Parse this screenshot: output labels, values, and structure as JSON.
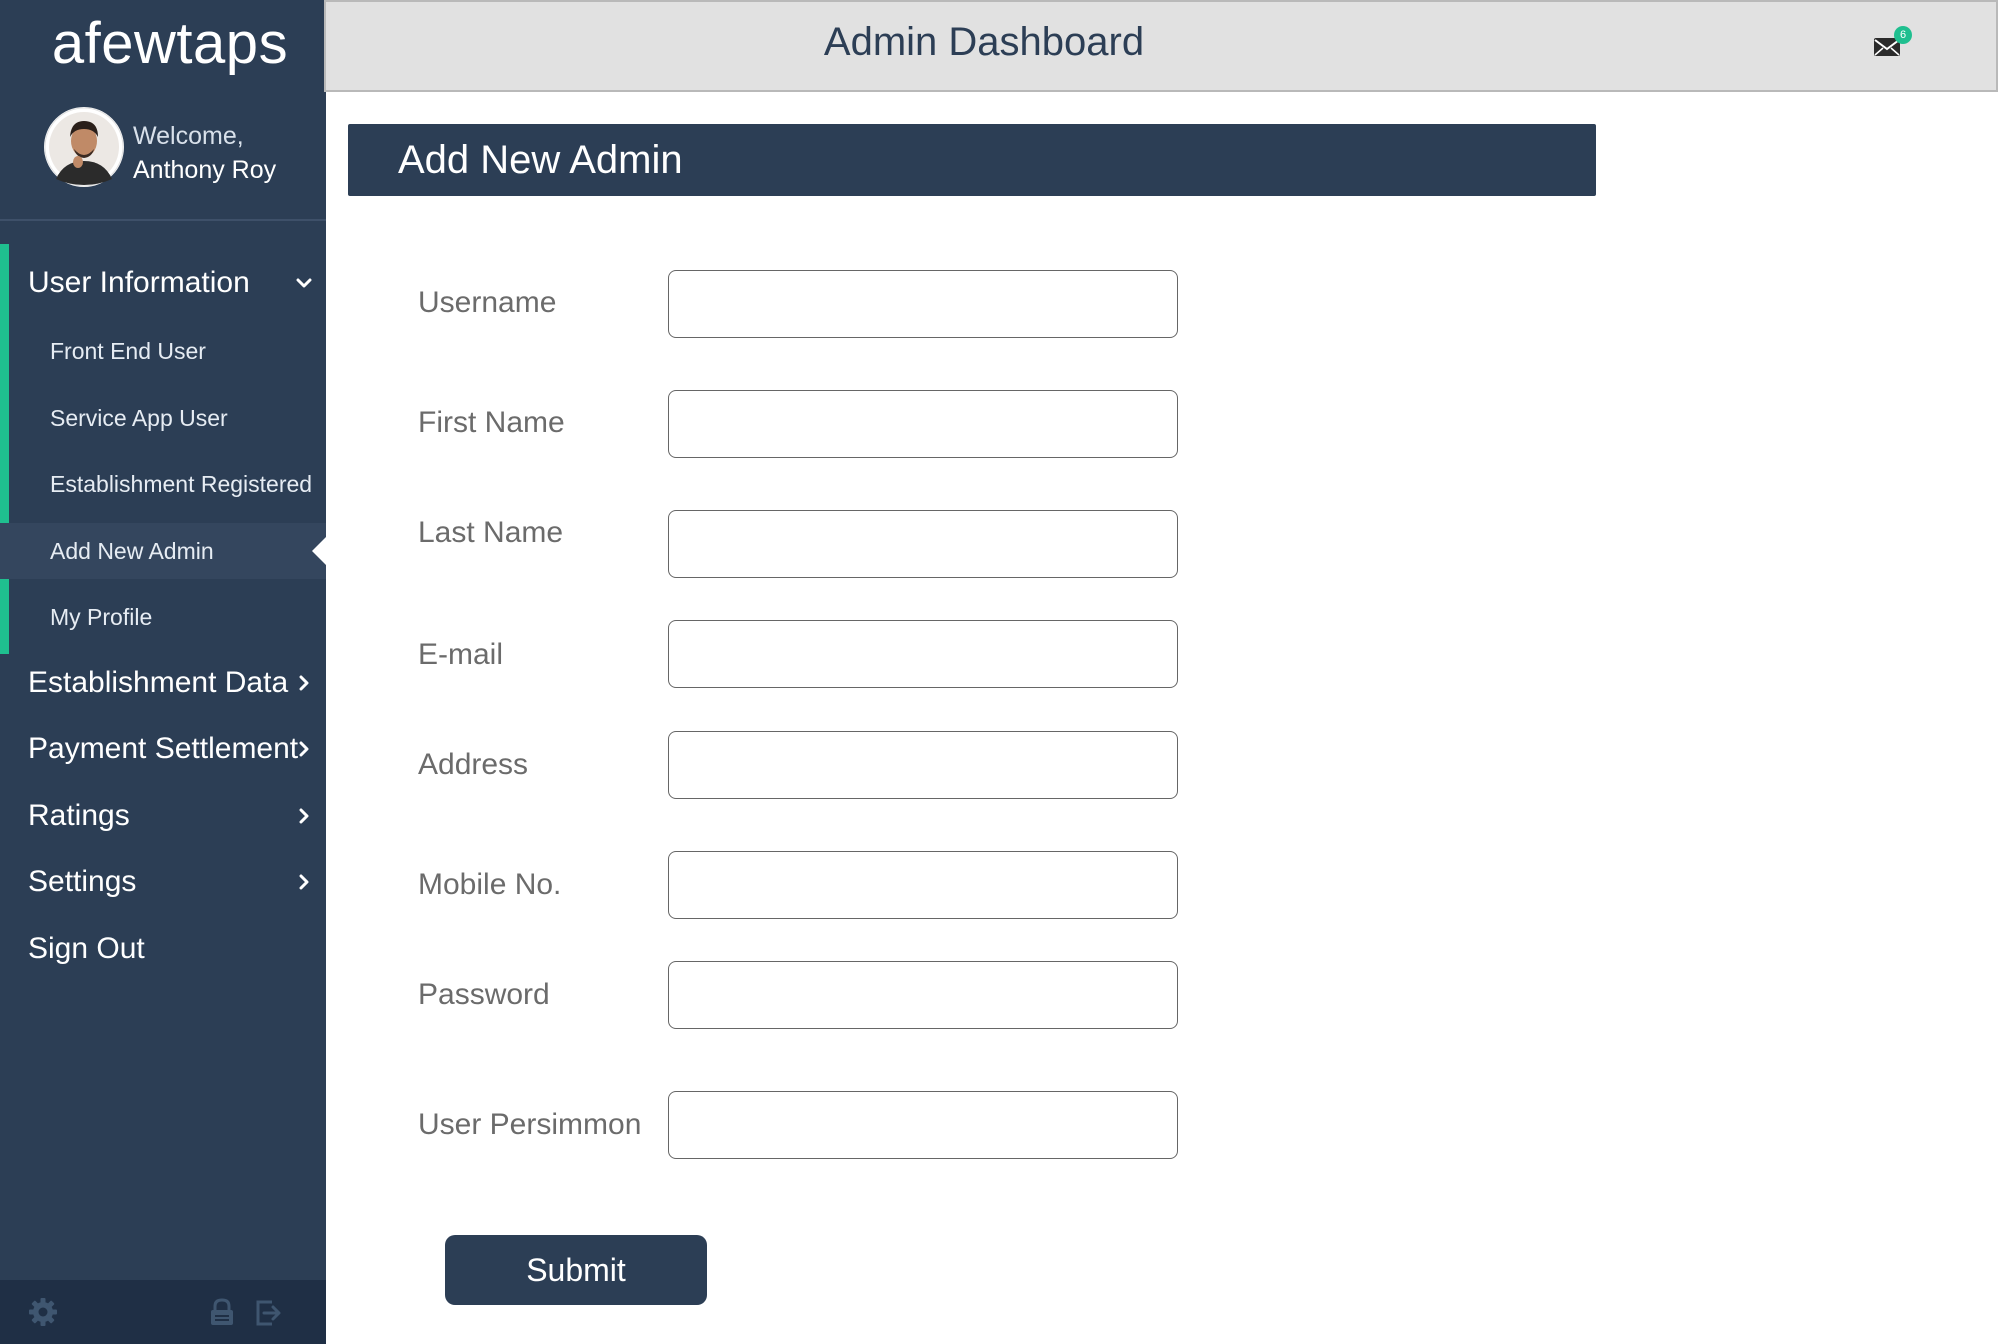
{
  "app": {
    "brand": "afewtaps"
  },
  "user": {
    "welcome": "Welcome,",
    "name": "Anthony Roy"
  },
  "header": {
    "title": "Admin Dashboard",
    "notification_count": "6",
    "mail_icon": "mail-icon"
  },
  "sidebar": {
    "sections": [
      {
        "label": "User Information",
        "expanded": true,
        "items": [
          {
            "label": "Front End User"
          },
          {
            "label": "Service App User"
          },
          {
            "label": "Establishment Registered"
          },
          {
            "label": "Add New Admin",
            "active": true
          },
          {
            "label": "My Profile"
          }
        ]
      },
      {
        "label": "Establishment Data"
      },
      {
        "label": "Payment Settlement"
      },
      {
        "label": "Ratings"
      },
      {
        "label": "Settings"
      },
      {
        "label": "Sign Out"
      }
    ],
    "footer_icons": [
      "gear-icon",
      "lock-icon",
      "logout-icon"
    ]
  },
  "page": {
    "heading": "Add New Admin"
  },
  "form": {
    "fields": [
      {
        "label": "Username",
        "value": ""
      },
      {
        "label": "First Name",
        "value": ""
      },
      {
        "label": "Last Name",
        "value": ""
      },
      {
        "label": "E-mail",
        "value": ""
      },
      {
        "label": "Address",
        "value": ""
      },
      {
        "label": "Mobile No.",
        "value": ""
      },
      {
        "label": "Password",
        "value": ""
      },
      {
        "label": "User Persimmon",
        "value": ""
      }
    ],
    "submit_label": "Submit"
  },
  "colors": {
    "sidebar": "#2c3e55",
    "accent": "#1fbf8f",
    "header": "#e1e1e1"
  }
}
